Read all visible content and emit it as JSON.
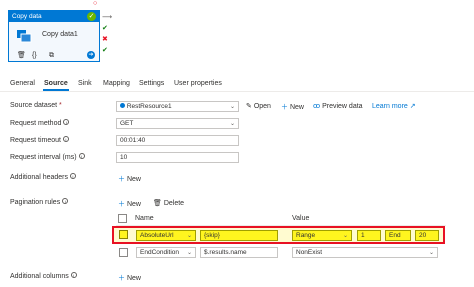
{
  "activity": {
    "header": "Copy data",
    "name": "Copy data1",
    "icons": {
      "check": "check-icon",
      "copy": "copy-data-icon",
      "delete": "trash-icon",
      "code": "code-braces-icon",
      "clone": "clone-icon",
      "go": "arrow-right-icon"
    }
  },
  "tabs": [
    "General",
    "Source",
    "Sink",
    "Mapping",
    "Settings",
    "User properties"
  ],
  "active_tab": "Source",
  "source": {
    "dataset_label": "Source dataset",
    "dataset_required": "*",
    "dataset_value": "RestResource1",
    "open_label": "Open",
    "new_label": "New",
    "preview_label": "Preview data",
    "learn_more_label": "Learn more",
    "method_label": "Request method",
    "method_value": "GET",
    "timeout_label": "Request timeout",
    "timeout_value": "00:01:40",
    "interval_label": "Request interval (ms)",
    "interval_value": "10",
    "headers_label": "Additional headers",
    "headers_new": "New",
    "pagination_label": "Pagination rules",
    "pagination_new": "New",
    "pagination_delete": "Delete",
    "col_name": "Name",
    "col_value": "Value",
    "rules": [
      {
        "name": "AbsoluteUrl",
        "key": "{skip}",
        "type": "Range",
        "start": "1",
        "end_label": "End",
        "end": "20"
      },
      {
        "name": "EndCondition",
        "key": "$.results.name",
        "type": "NonExist"
      }
    ],
    "columns_label": "Additional columns",
    "columns_new": "New"
  },
  "colors": {
    "accent": "#0078d4",
    "highlight_border": "#e81123",
    "highlight_fill": "#fff51f"
  }
}
